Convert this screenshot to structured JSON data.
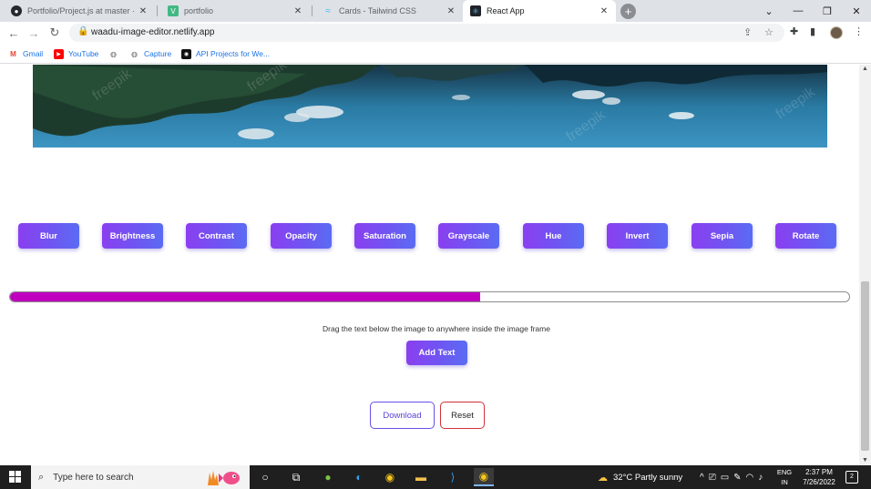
{
  "browser": {
    "tabs": [
      {
        "title": "Portfolio/Project.js at master · Sh",
        "icon": "github-icon",
        "active": false
      },
      {
        "title": "portfolio",
        "icon": "vue-icon",
        "active": false
      },
      {
        "title": "Cards - Tailwind CSS",
        "icon": "tailwind-icon",
        "active": false
      },
      {
        "title": "React App",
        "icon": "react-icon",
        "active": true
      }
    ],
    "tab_close_glyph": "✕",
    "new_tab_glyph": "+",
    "url": "waadu-image-editor.netlify.app",
    "bookmarks": [
      {
        "label": "Gmail",
        "icon": "gmail-icon"
      },
      {
        "label": "YouTube",
        "icon": "youtube-icon"
      },
      {
        "label": "",
        "icon": "globe-icon"
      },
      {
        "label": "Capture",
        "icon": "globe-icon"
      },
      {
        "label": "API Projects for We...",
        "icon": "api-icon"
      }
    ]
  },
  "editor": {
    "filters": [
      "Blur",
      "Brightness",
      "Contrast",
      "Opacity",
      "Saturation",
      "Grayscale",
      "Hue",
      "Invert",
      "Sepia",
      "Rotate"
    ],
    "slider_value_percent": 56,
    "hint": "Drag the text below the image to anywhere inside the image frame",
    "add_text_label": "Add Text",
    "download_label": "Download",
    "reset_label": "Reset",
    "watermark": "freepik"
  },
  "taskbar": {
    "search_placeholder": "Type here to search",
    "weather": "32°C  Partly sunny",
    "lang_top": "ENG",
    "lang_bottom": "IN",
    "time": "2:37 PM",
    "date": "7/26/2022",
    "notification_count": "2"
  },
  "colors": {
    "button_gradient_start": "#8a3ff0",
    "button_gradient_end": "#5a6cf3",
    "slider_fill": "#bf00bf",
    "download_border": "#6a4ee8",
    "reset_border": "#d32f3b"
  }
}
